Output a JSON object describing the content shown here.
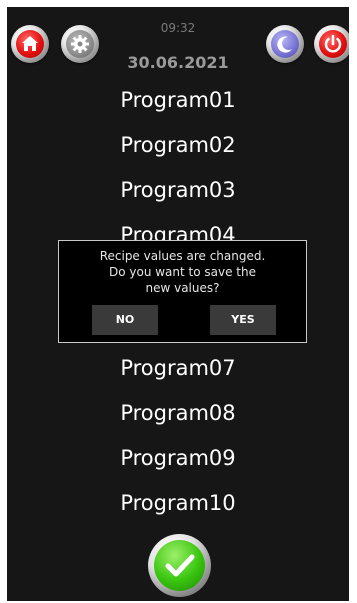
{
  "header": {
    "time": "09:32",
    "date": "30.06.2021",
    "buttons": {
      "home": "home-icon",
      "settings": "gear-icon",
      "night_mode": "moon-icon",
      "power": "power-icon"
    }
  },
  "programs": [
    "Program01",
    "Program02",
    "Program03",
    "Program04",
    "Program07",
    "Program08",
    "Program09",
    "Program10"
  ],
  "dialog": {
    "message_line1": "Recipe values are changed.",
    "message_line2": "Do you want to save the",
    "message_line3": "new values?",
    "no_label": "NO",
    "yes_label": "YES"
  },
  "footer": {
    "confirm_icon": "checkmark-icon"
  },
  "colors": {
    "background": "#161616",
    "accent_red": "#e41010",
    "accent_green": "#38c40e",
    "moon_purple": "#7b77d6"
  }
}
